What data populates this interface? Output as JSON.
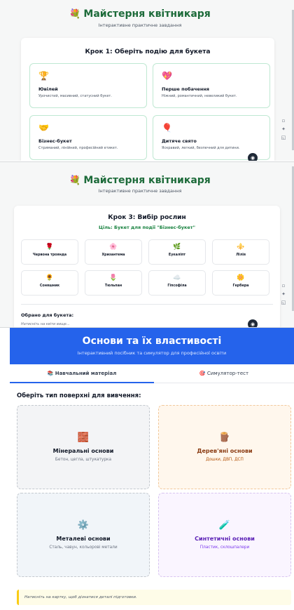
{
  "app": {
    "title": "Майстерня квітникаря",
    "title_emoji": "💐",
    "subtitle": "Інтерактивне практичне завдання"
  },
  "step1": {
    "heading": "Крок 1: Оберіть подію для букета",
    "events": [
      {
        "icon": "🏆",
        "icon_name": "trophy-icon",
        "name": "Ювілей",
        "desc": "Урочистий, масивний, статусний букет."
      },
      {
        "icon": "💖",
        "icon_name": "heart-icon",
        "name": "Перше побачення",
        "desc": "Ніжний, романтичний, невеликий букет."
      },
      {
        "icon": "🤝",
        "icon_name": "handshake-icon",
        "name": "Бізнес-букет",
        "desc": "Стриманий, лінійний, професійний етикет."
      },
      {
        "icon": "🎈",
        "icon_name": "balloon-icon",
        "name": "Дитяче свято",
        "desc": "Яскравий, легкий, безпечний для дитини."
      }
    ]
  },
  "step3": {
    "heading": "Крок 3: Вибір рослин",
    "goal": "Ціль: Букет для події \"Бізнес-букет\"",
    "plants": [
      {
        "icon": "🌹",
        "icon_name": "rose-icon",
        "name": "Червона троянда"
      },
      {
        "icon": "🌸",
        "icon_name": "chrysanthemum-icon",
        "name": "Хризантема"
      },
      {
        "icon": "🌿",
        "icon_name": "eucalyptus-icon",
        "name": "Еукаліпт"
      },
      {
        "icon": "⚜️",
        "icon_name": "lily-icon",
        "name": "Лілія"
      },
      {
        "icon": "🌻",
        "icon_name": "sunflower-icon",
        "name": "Соняшник"
      },
      {
        "icon": "🌷",
        "icon_name": "tulip-icon",
        "name": "Тюльпан"
      },
      {
        "icon": "☁️",
        "icon_name": "gypsophila-icon",
        "name": "Гіпсофіла"
      },
      {
        "icon": "🌼",
        "icon_name": "gerbera-icon",
        "name": "Гербера"
      }
    ],
    "chosen_label": "Обрано для букета:",
    "chosen_hint": "Натисніть на квіти вище..."
  },
  "surfaces_app": {
    "title": "Основи та їх властивості",
    "subtitle": "Інтерактивний посібник та симулятор для професійної освіти",
    "tabs": [
      {
        "icon": "📚",
        "label": "Навчальний матеріал"
      },
      {
        "icon": "🎯",
        "label": "Симулятор-тест"
      }
    ],
    "heading": "Оберіть тип поверхні для вивчення:",
    "cards": [
      {
        "icon": "🧱",
        "icon_name": "brick-icon",
        "name": "Мінеральні основи",
        "desc": "Бетон, цегла, штукатурка"
      },
      {
        "icon": "🪵",
        "icon_name": "wood-icon",
        "name": "Дерев'яні основи",
        "desc": "Дошки, ДВП, ДСП"
      },
      {
        "icon": "⚙️",
        "icon_name": "gear-icon",
        "name": "Металеві основи",
        "desc": "Сталь, чавун, кольорові метали"
      },
      {
        "icon": "🧪",
        "icon_name": "test-tube-icon",
        "name": "Синтетичні основи",
        "desc": "Пластик, склошпалери"
      }
    ],
    "hint": "Натисніть на картку, щоб дізнатися деталі підготовки."
  },
  "colors": {
    "brand_green": "#1d6b3a",
    "accent_blue": "#2563eb"
  }
}
